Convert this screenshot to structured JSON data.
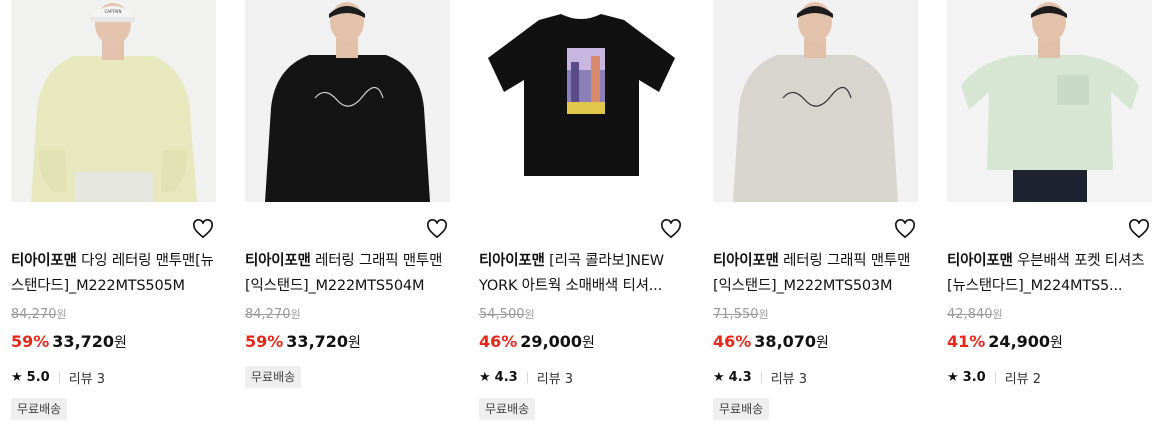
{
  "products": [
    {
      "brand": "티아이포맨",
      "name": "다잉 레터링 맨투맨[뉴스탠다드]_M222MTS505M",
      "original_price": "84,270",
      "original_unit": "원",
      "discount": "59%",
      "price": "33,720",
      "price_unit": "원",
      "rating": "5.0",
      "review": "리뷰 3",
      "tag": "무료배송",
      "image_icon": "yellow-sweatshirt-model-image"
    },
    {
      "brand": "티아이포맨",
      "name": "레터링 그래픽 맨투맨[익스탠드]_M222MTS504M",
      "original_price": "84,270",
      "original_unit": "원",
      "discount": "59%",
      "price": "33,720",
      "price_unit": "원",
      "tag": "무료배송",
      "image_icon": "black-sweatshirt-model-image"
    },
    {
      "brand": "티아이포맨",
      "name": "[리곡 콜라보]NEW YORK 아트웍 소매배색 티셔...",
      "original_price": "54,500",
      "original_unit": "원",
      "discount": "46%",
      "price": "29,000",
      "price_unit": "원",
      "rating": "4.3",
      "review": "리뷰 3",
      "tag": "무료배송",
      "image_icon": "black-tshirt-artwork-image"
    },
    {
      "brand": "티아이포맨",
      "name": "레터링 그래픽 맨투맨[익스탠드]_M222MTS503M",
      "original_price": "71,550",
      "original_unit": "원",
      "discount": "46%",
      "price": "38,070",
      "price_unit": "원",
      "rating": "4.3",
      "review": "리뷰 3",
      "tag": "무료배송",
      "image_icon": "gray-sweatshirt-model-image"
    },
    {
      "brand": "티아이포맨",
      "name": "우븐배색 포켓 티셔츠[뉴스탠다드]_M224MTS5...",
      "original_price": "42,840",
      "original_unit": "원",
      "discount": "41%",
      "price": "24,900",
      "price_unit": "원",
      "rating": "3.0",
      "review": "리뷰 2",
      "image_icon": "mint-tshirt-model-image"
    }
  ],
  "colors": {
    "discount": "#e8271c",
    "strike": "#9a9a9a",
    "tag_bg": "#eeeeee"
  }
}
